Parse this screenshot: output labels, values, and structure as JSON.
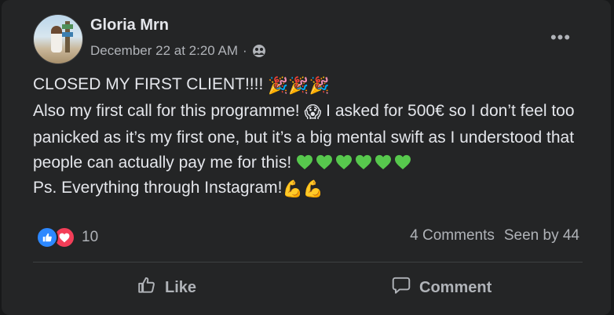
{
  "post": {
    "author": "Gloria Mrn",
    "timestamp": "December 22 at 2:20 AM",
    "separator": "·",
    "audience_icon": "group-icon",
    "more_label": "•••",
    "lines": {
      "line1": "CLOSED MY FIRST CLIENT!!!! ",
      "line2a": "Also my first call for this programme! ",
      "line2b": " I asked for 500€ so I don’t feel too panicked as it’s my first one, but it’s a big mental swift as I understood that people can actually pay me for this! ",
      "line3": "Ps. Everything through Instagram!"
    },
    "emoji": {
      "party": "🎉",
      "scream": "😱",
      "muscle": "💪",
      "green_heart_color": "#57c84d"
    },
    "reactions": {
      "count": "10",
      "types": [
        "like",
        "love"
      ],
      "like_color": "#2d88ff",
      "love_color": "#f33e58"
    },
    "stats": {
      "comments": "4 Comments",
      "seen": "Seen by 44"
    },
    "actions": {
      "like_label": "Like",
      "comment_label": "Comment"
    }
  }
}
